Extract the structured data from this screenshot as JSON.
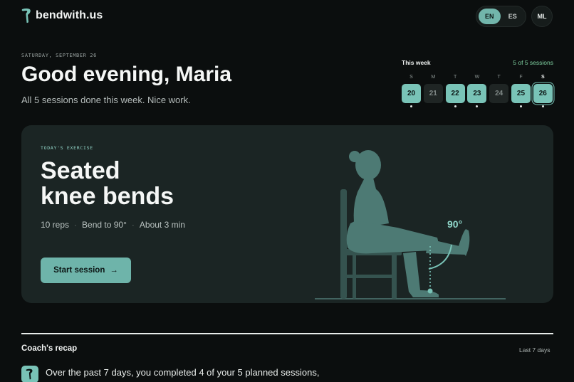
{
  "brand": {
    "name": "bendwith.us"
  },
  "header": {
    "languages": [
      {
        "code": "EN",
        "active": true
      },
      {
        "code": "ES",
        "active": false
      }
    ],
    "avatar_initials": "ML"
  },
  "hero": {
    "date": "SATURDAY, SEPTEMBER 26",
    "greeting": "Good evening, Maria",
    "subline": "All 5 sessions done this week. Nice work."
  },
  "week": {
    "title": "This week",
    "count": "5 of 5 sessions",
    "days": [
      {
        "letter": "S",
        "date": "20",
        "done": true,
        "today": false
      },
      {
        "letter": "M",
        "date": "21",
        "done": false,
        "today": false
      },
      {
        "letter": "T",
        "date": "22",
        "done": true,
        "today": false
      },
      {
        "letter": "W",
        "date": "23",
        "done": true,
        "today": false
      },
      {
        "letter": "T",
        "date": "24",
        "done": false,
        "today": false
      },
      {
        "letter": "F",
        "date": "25",
        "done": true,
        "today": false
      },
      {
        "letter": "S",
        "date": "26",
        "done": true,
        "today": true
      }
    ]
  },
  "exercise": {
    "tag": "TODAY'S EXERCISE",
    "title_line1": "Seated",
    "title_line2": "knee bends",
    "reps": "10 reps",
    "angle_text": "Bend to 90°",
    "duration": "About 3 min",
    "start_label": "Start session",
    "start_arrow": "→",
    "angle_label": "90°"
  },
  "recap": {
    "title": "Coach's recap",
    "range": "Last 7 days",
    "text": "Over the past 7 days, you completed 4 of your 5 planned sessions,"
  },
  "colors": {
    "accent": "#79c3b7",
    "background": "#0b0e0e",
    "card": "#1b2524",
    "success": "#7fd0a0"
  }
}
